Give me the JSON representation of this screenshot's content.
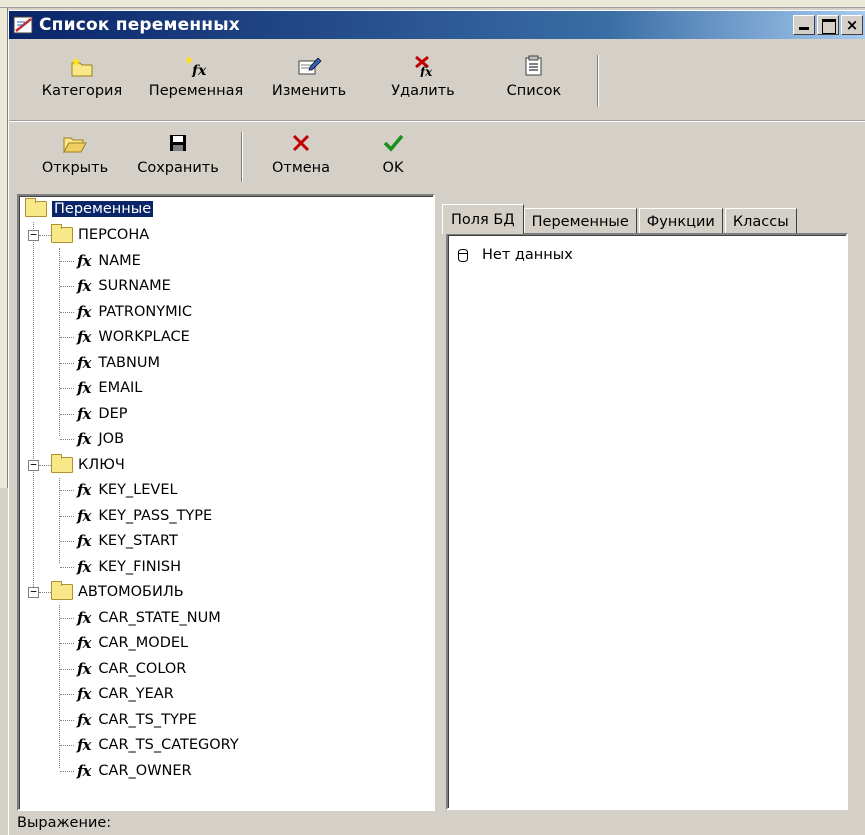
{
  "window": {
    "title": "Список переменных"
  },
  "title_buttons": {
    "minimize": "_",
    "maximize": "□",
    "close": "×"
  },
  "toolbar1": [
    {
      "label": "Категория",
      "icon": "new-folder-icon"
    },
    {
      "label": "Переменная",
      "icon": "new-variable-icon"
    },
    {
      "label": "Изменить",
      "icon": "edit-icon"
    },
    {
      "label": "Удалить",
      "icon": "delete-variable-icon"
    },
    {
      "label": "Список",
      "icon": "list-icon"
    }
  ],
  "toolbar2": [
    {
      "label": "Открыть",
      "icon": "open-folder-icon"
    },
    {
      "label": "Сохранить",
      "icon": "save-icon"
    },
    {
      "label": "Отмена",
      "icon": "cancel-x-icon"
    },
    {
      "label": "OK",
      "icon": "ok-check-icon"
    }
  ],
  "tree": {
    "root": "Переменные",
    "fx_symbol": "fx",
    "categories": [
      {
        "name": "ПЕРСОНА",
        "items": [
          "NAME",
          "SURNAME",
          "PATRONYMIC",
          "WORKPLACE",
          "TABNUM",
          "EMAIL",
          "DEP",
          "JOB"
        ]
      },
      {
        "name": "КЛЮЧ",
        "items": [
          "KEY_LEVEL",
          "KEY_PASS_TYPE",
          "KEY_START",
          "KEY_FINISH"
        ]
      },
      {
        "name": "АВТОМОБИЛЬ",
        "items": [
          "CAR_STATE_NUM",
          "CAR_MODEL",
          "CAR_COLOR",
          "CAR_YEAR",
          "CAR_TS_TYPE",
          "CAR_TS_CATEGORY",
          "CAR_OWNER"
        ]
      }
    ]
  },
  "tabs": [
    "Поля БД",
    "Переменные",
    "Функции",
    "Классы"
  ],
  "active_tab": 0,
  "panel": {
    "empty_text": "Нет данных"
  },
  "status": {
    "expression_label": "Выражение:"
  },
  "colors": {
    "title_start": "#0a246a",
    "title_end": "#a6caf0",
    "face": "#d4d0c8",
    "folder": "#f8e888",
    "delete_red": "#c00000",
    "ok_green": "#1a8f1a"
  }
}
